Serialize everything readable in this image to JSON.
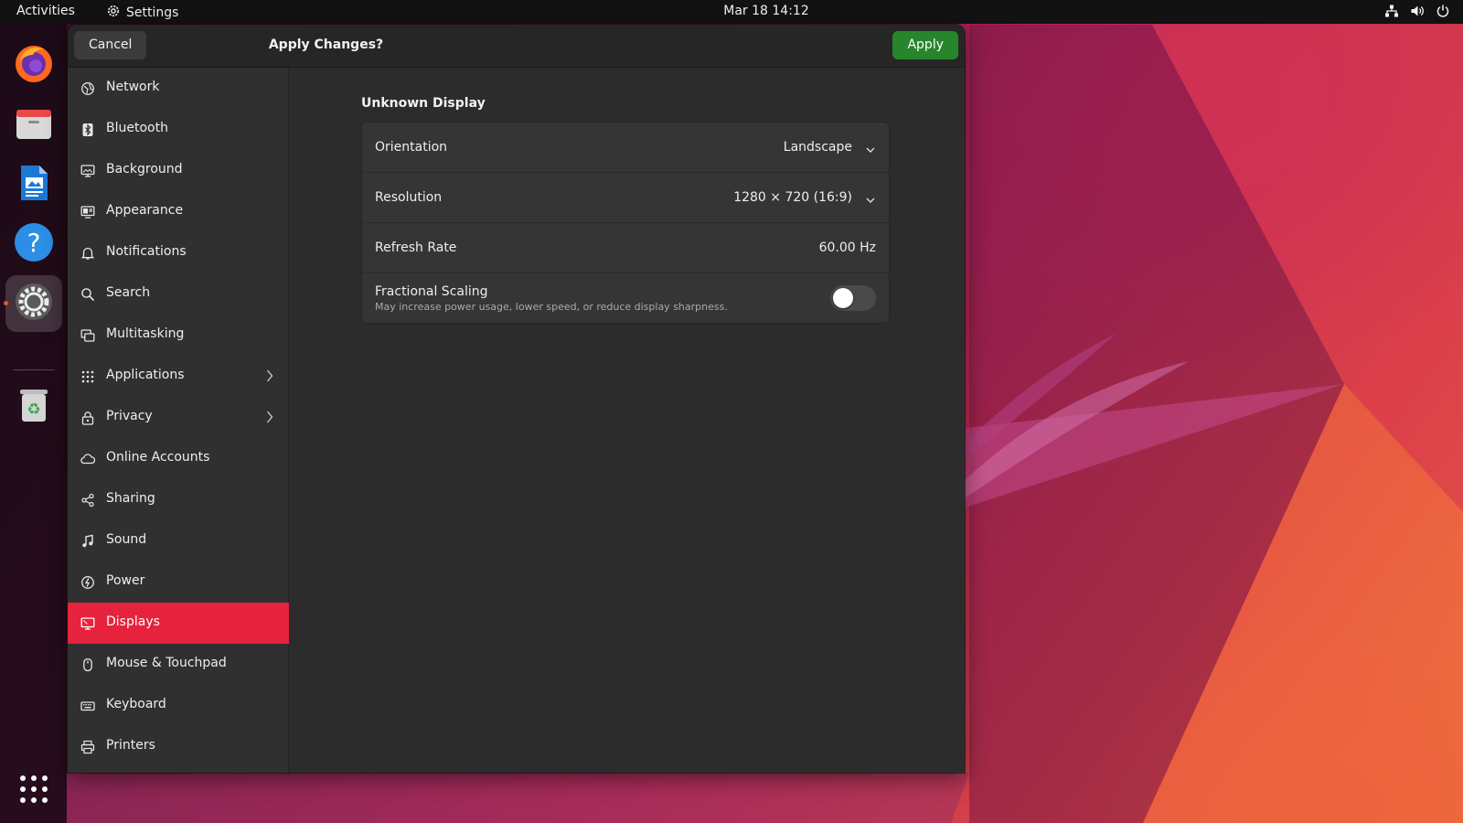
{
  "topbar": {
    "activities": "Activities",
    "app_name": "Settings",
    "clock": "Mar 18  14:12"
  },
  "dock": {
    "items": [
      {
        "name": "firefox-icon"
      },
      {
        "name": "files-icon"
      },
      {
        "name": "writer-icon"
      },
      {
        "name": "help-icon"
      },
      {
        "name": "settings-icon",
        "active": true
      },
      {
        "name": "trash-icon"
      },
      {
        "name": "app-grid-icon"
      }
    ]
  },
  "window": {
    "header": {
      "cancel_label": "Cancel",
      "title": "Apply Changes?",
      "apply_label": "Apply"
    },
    "sidebar": {
      "items": [
        {
          "label": "Network",
          "icon": "globe-icon"
        },
        {
          "label": "Bluetooth",
          "icon": "bluetooth-icon"
        },
        {
          "label": "Background",
          "icon": "monitor-icon"
        },
        {
          "label": "Appearance",
          "icon": "appearance-icon"
        },
        {
          "label": "Notifications",
          "icon": "bell-icon"
        },
        {
          "label": "Search",
          "icon": "search-icon"
        },
        {
          "label": "Multitasking",
          "icon": "multitasking-icon"
        },
        {
          "label": "Applications",
          "icon": "grid-icon",
          "has_submenu": true
        },
        {
          "label": "Privacy",
          "icon": "lock-icon",
          "has_submenu": true
        },
        {
          "label": "Online Accounts",
          "icon": "cloud-icon"
        },
        {
          "label": "Sharing",
          "icon": "share-icon"
        },
        {
          "label": "Sound",
          "icon": "music-note-icon"
        },
        {
          "label": "Power",
          "icon": "power-icon"
        },
        {
          "label": "Displays",
          "icon": "display-icon",
          "selected": true
        },
        {
          "label": "Mouse & Touchpad",
          "icon": "mouse-icon"
        },
        {
          "label": "Keyboard",
          "icon": "keyboard-icon"
        },
        {
          "label": "Printers",
          "icon": "printer-icon"
        }
      ]
    },
    "displays": {
      "section_title": "Unknown Display",
      "orientation": {
        "label": "Orientation",
        "value": "Landscape"
      },
      "resolution": {
        "label": "Resolution",
        "value": "1280 × 720 (16:9)"
      },
      "refresh_rate": {
        "label": "Refresh Rate",
        "value": "60.00 Hz"
      },
      "fractional_scaling": {
        "label": "Fractional Scaling",
        "description": "May increase power usage, lower speed, or reduce display sharpness.",
        "enabled": false
      }
    }
  },
  "colors": {
    "selected": "#e6223d",
    "apply_button": "#27852c",
    "ubuntu_orange": "#e95420"
  }
}
